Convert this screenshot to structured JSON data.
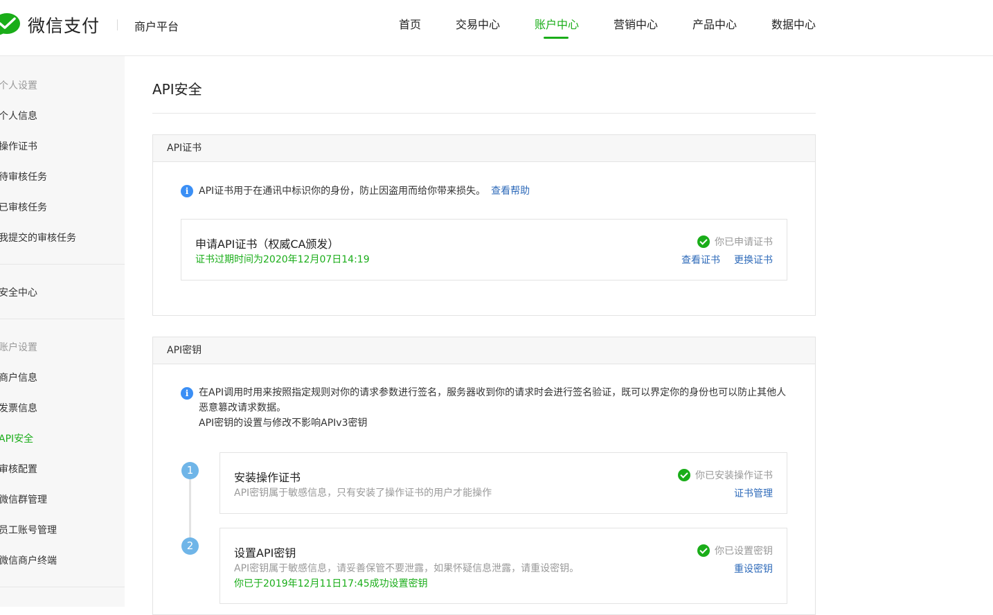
{
  "header": {
    "brand_name": "微信支付",
    "platform_name": "商户平台",
    "nav": [
      {
        "label": "首页"
      },
      {
        "label": "交易中心"
      },
      {
        "label": "账户中心",
        "active": true
      },
      {
        "label": "营销中心"
      },
      {
        "label": "产品中心"
      },
      {
        "label": "数据中心"
      }
    ]
  },
  "sidebar": {
    "group1_title": "个人设置",
    "group1_items": [
      "个人信息",
      "操作证书",
      "待审核任务",
      "已审核任务",
      "我提交的审核任务"
    ],
    "security_center": "安全中心",
    "group2_title": "账户设置",
    "group2_items": [
      "商户信息",
      "发票信息",
      "API安全",
      "审核配置",
      "微信群管理",
      "员工账号管理",
      "微信商户终端"
    ]
  },
  "main": {
    "page_title": "API安全",
    "cert_panel": {
      "title": "API证书",
      "info": "API证书用于在通讯中标识你的身份，防止因盗用而给你带来损失。",
      "help_link": "查看帮助",
      "card": {
        "title": "申请API证书（权威CA颁发）",
        "expiry": "证书过期时间为2020年12月07日14:19",
        "status": "你已申请证书",
        "view_link": "查看证书",
        "replace_link": "更换证书"
      }
    },
    "key_panel": {
      "title": "API密钥",
      "info_line1": "在API调用时用来按照指定规则对你的请求参数进行签名，服务器收到你的请求时会进行签名验证，既可以界定你的身份也可以防止其他人",
      "info_line2": "恶意篡改请求数据。",
      "info_line3": "API密钥的设置与修改不影响APIv3密钥",
      "steps": [
        {
          "number": "1",
          "title": "安装操作证书",
          "desc": "API密钥属于敏感信息，只有安装了操作证书的用户才能操作",
          "status": "你已安装操作证书",
          "action": "证书管理"
        },
        {
          "number": "2",
          "title": "设置API密钥",
          "desc": "API密钥属于敏感信息，请妥善保管不要泄露，如果怀疑信息泄露，请重设密钥。",
          "note": "你已于2019年12月11日17:45成功设置密钥",
          "status": "你已设置密钥",
          "action": "重设密钥"
        }
      ]
    }
  },
  "colors": {
    "accent_green": "#1aad19",
    "link_blue": "#2f6bba",
    "info_blue": "#3b8ff5",
    "step_blue": "#6fb5e8"
  }
}
